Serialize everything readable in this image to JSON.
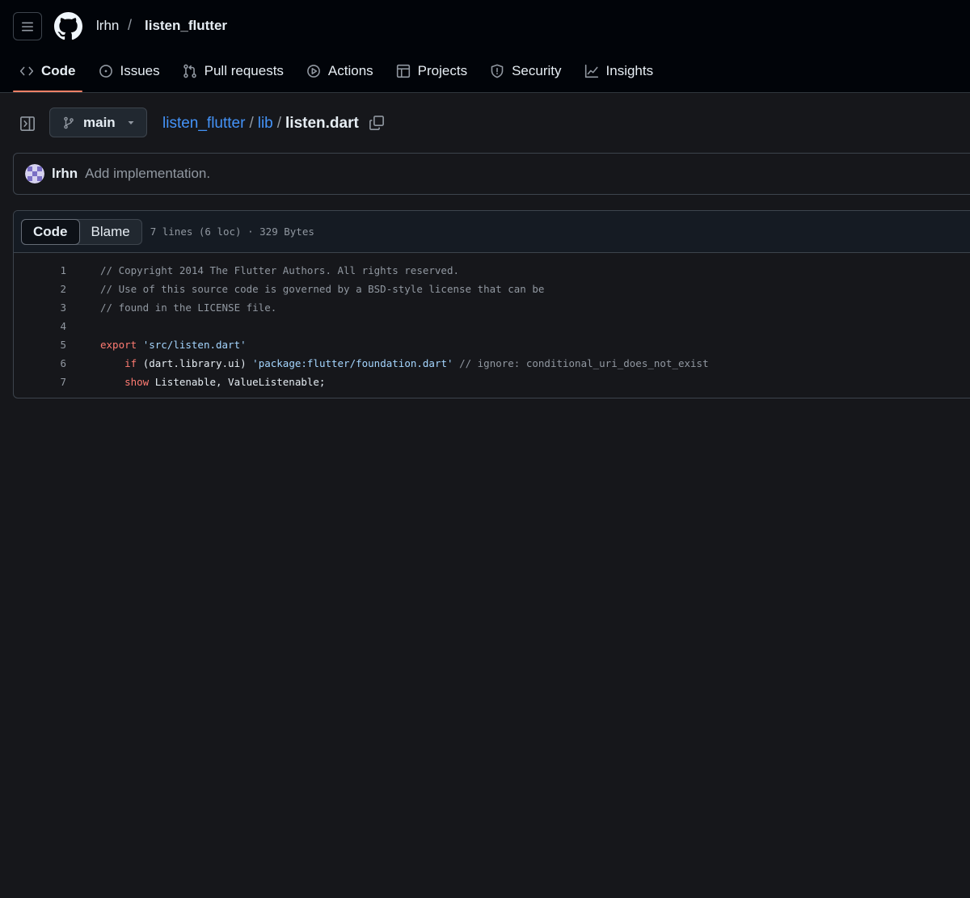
{
  "colors": {
    "background": "#16171b",
    "header_bg": "#010409",
    "accent_underline": "#f78166",
    "link": "#4493f8",
    "comment": "#9198a1",
    "keyword": "#ff7b72",
    "string": "#a5d6ff"
  },
  "header": {
    "owner": "lrhn",
    "separator": "/",
    "repo": "listen_flutter"
  },
  "nav": {
    "tabs": [
      {
        "label": "Code",
        "icon": "code-icon"
      },
      {
        "label": "Issues",
        "icon": "issue-opened-icon"
      },
      {
        "label": "Pull requests",
        "icon": "git-pull-request-icon"
      },
      {
        "label": "Actions",
        "icon": "play-icon"
      },
      {
        "label": "Projects",
        "icon": "table-icon"
      },
      {
        "label": "Security",
        "icon": "shield-icon"
      },
      {
        "label": "Insights",
        "icon": "graph-icon"
      }
    ]
  },
  "filebar": {
    "branch": "main",
    "path": {
      "repo": "listen_flutter",
      "dir": "lib",
      "file": "listen.dart",
      "separator": "/"
    }
  },
  "commit": {
    "author": "lrhn",
    "message": "Add implementation."
  },
  "code_view": {
    "tabs": [
      "Code",
      "Blame"
    ],
    "meta": "7 lines (6 loc) · 329 Bytes",
    "lines": [
      {
        "number": "1",
        "tokens": [
          {
            "t": "comment",
            "v": "// Copyright 2014 The Flutter Authors. All rights reserved."
          }
        ]
      },
      {
        "number": "2",
        "tokens": [
          {
            "t": "comment",
            "v": "// Use of this source code is governed by a BSD-style license that can be"
          }
        ]
      },
      {
        "number": "3",
        "tokens": [
          {
            "t": "comment",
            "v": "// found in the LICENSE file."
          }
        ]
      },
      {
        "number": "4",
        "tokens": []
      },
      {
        "number": "5",
        "tokens": [
          {
            "t": "keyword",
            "v": "export"
          },
          {
            "t": "plain",
            "v": " "
          },
          {
            "t": "string",
            "v": "'src/listen.dart'"
          }
        ]
      },
      {
        "number": "6",
        "tokens": [
          {
            "t": "plain",
            "v": "    "
          },
          {
            "t": "keyword",
            "v": "if"
          },
          {
            "t": "plain",
            "v": " (dart.library.ui) "
          },
          {
            "t": "string",
            "v": "'package:flutter/foundation.dart'"
          },
          {
            "t": "plain",
            "v": " "
          },
          {
            "t": "comment",
            "v": "// ignore: conditional_uri_does_not_exist"
          }
        ]
      },
      {
        "number": "7",
        "tokens": [
          {
            "t": "plain",
            "v": "    "
          },
          {
            "t": "keyword",
            "v": "show"
          },
          {
            "t": "plain",
            "v": " Listenable, ValueListenable;"
          }
        ]
      }
    ]
  }
}
